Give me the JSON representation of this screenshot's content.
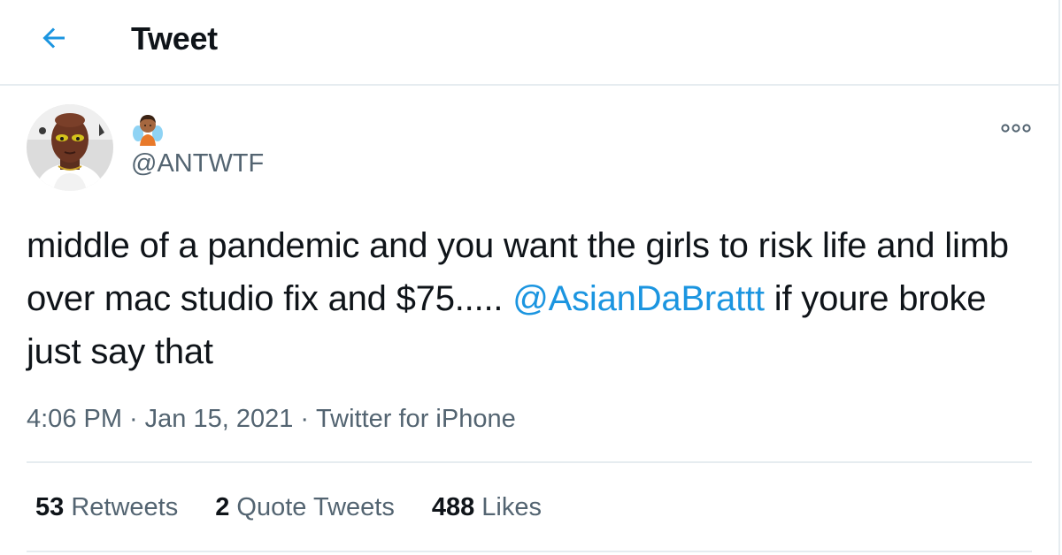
{
  "header": {
    "back_icon": "arrow-left-icon",
    "title": "Tweet",
    "accent_color": "#1b95e0"
  },
  "author": {
    "avatar_icon": "user-avatar",
    "name_emoji_icon": "fairy-emoji-icon",
    "handle": "@ANTWTF"
  },
  "more_icon": "ellipsis-icon",
  "tweet": {
    "text_part1": "middle of a pandemic and you want the girls to risk life and limb over mac studio fix and $75..... ",
    "mention": "@AsianDaBrattt",
    "text_part2": " if youre broke just say that"
  },
  "meta": {
    "time": "4:06 PM",
    "separator": "·",
    "date": "Jan 15, 2021",
    "source": "Twitter for iPhone"
  },
  "stats": [
    {
      "count": "53",
      "label": "Retweets"
    },
    {
      "count": "2",
      "label": "Quote Tweets"
    },
    {
      "count": "488",
      "label": "Likes"
    }
  ]
}
